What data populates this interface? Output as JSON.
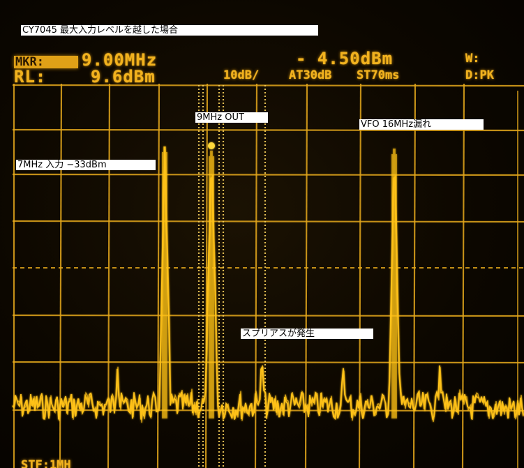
{
  "caption": "CY7045  最大入力レベルを越した場合",
  "readout": {
    "marker_label": "MKR:",
    "marker_freq": "9.00MHz",
    "marker_level": "- 4.50dBm",
    "w_label": "W:",
    "ref_label": "RL:",
    "ref_level": "9.6dBm",
    "scale": "10dB/",
    "attenuation": "AT30dB",
    "sweep_time": "ST70ms",
    "detector": "D:PK",
    "bottom_partial": "STF:1MH"
  },
  "annotations": {
    "input": "7MHz  入力  −33dBm",
    "output": "9MHz  OUT",
    "vfo": "VFO  16MHz漏れ",
    "spurious": "スプリアスが発生"
  },
  "colors": {
    "trace": "#ffc21a",
    "graticule": "#e3a71c",
    "label_bg": "#ffffff",
    "label_text": "#000000"
  }
}
